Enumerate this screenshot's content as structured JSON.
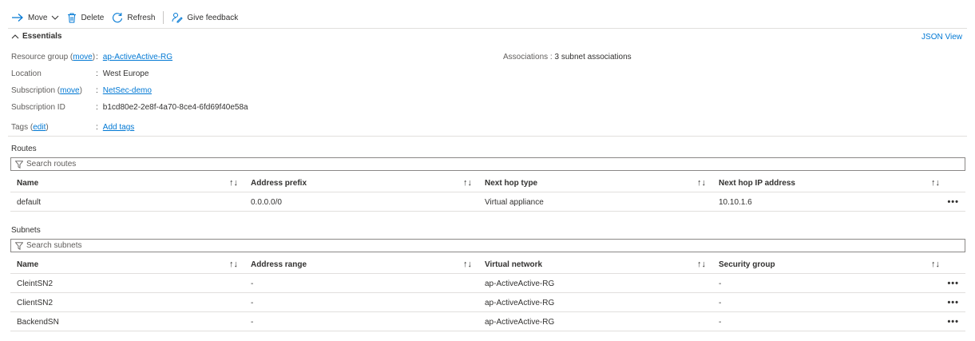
{
  "toolbar": {
    "move": "Move",
    "delete": "Delete",
    "refresh": "Refresh",
    "feedback": "Give feedback"
  },
  "essentials": {
    "title": "Essentials",
    "json_view": "JSON View",
    "resource_group_label": "Resource group",
    "move_link": "move",
    "resource_group_value": "ap-ActiveActive-RG",
    "location_label": "Location",
    "location_value": "West Europe",
    "subscription_label": "Subscription",
    "subscription_value": "NetSec-demo",
    "subscription_id_label": "Subscription ID",
    "subscription_id_value": "b1cd80e2-2e8f-4a70-8ce4-6fd69f40e58a",
    "tags_label": "Tags",
    "edit_link": "edit",
    "tags_value": "Add tags",
    "associations_label": "Associations",
    "associations_value": "3 subnet associations"
  },
  "routes": {
    "title": "Routes",
    "search_placeholder": "Search routes",
    "columns": [
      "Name",
      "Address prefix",
      "Next hop type",
      "Next hop IP address"
    ],
    "rows": [
      [
        "default",
        "0.0.0.0/0",
        "Virtual appliance",
        "10.10.1.6"
      ]
    ]
  },
  "subnets": {
    "title": "Subnets",
    "search_placeholder": "Search subnets",
    "columns": [
      "Name",
      "Address range",
      "Virtual network",
      "Security group"
    ],
    "rows": [
      [
        "CleintSN2",
        "-",
        "ap-ActiveActive-RG",
        "-"
      ],
      [
        "ClientSN2",
        "-",
        "ap-ActiveActive-RG",
        "-"
      ],
      [
        "BackendSN",
        "-",
        "ap-ActiveActive-RG",
        "-"
      ]
    ]
  },
  "glyphs": {
    "sort": "↑↓",
    "more": "•••",
    "colon": ":"
  }
}
